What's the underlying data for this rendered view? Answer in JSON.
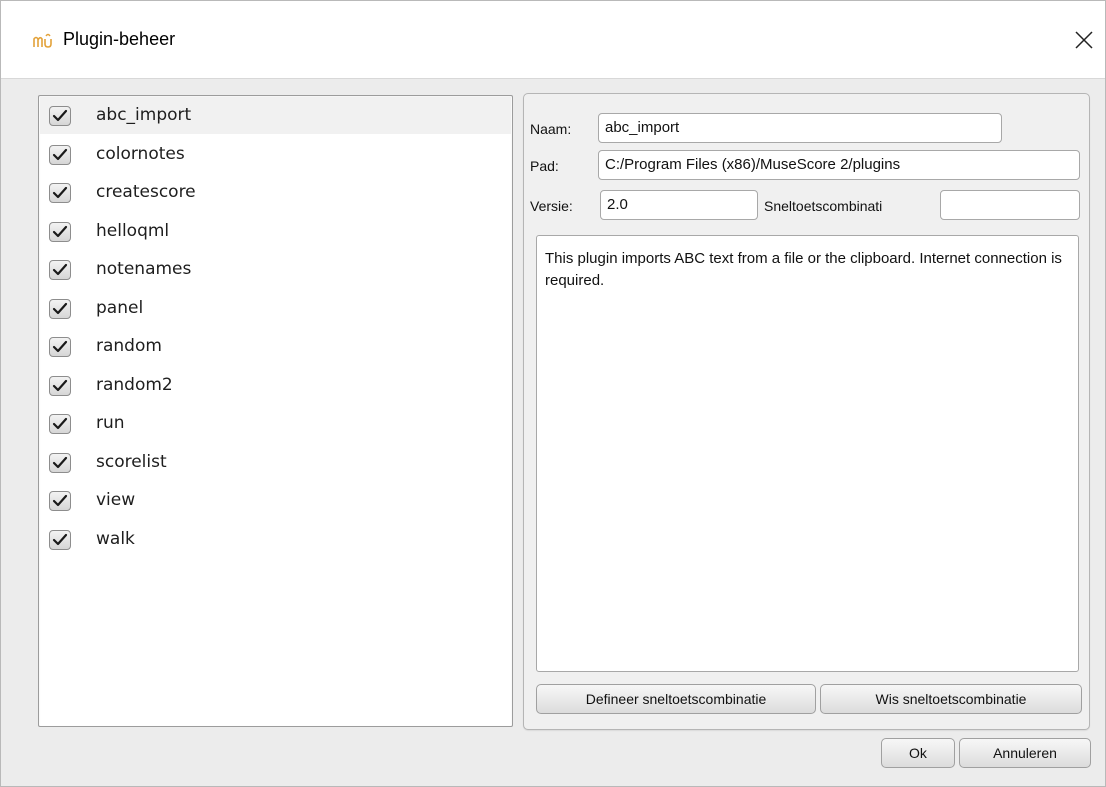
{
  "window": {
    "title": "Plugin-beheer"
  },
  "plugins": [
    {
      "label": "abc_import",
      "checked": true,
      "selected": true
    },
    {
      "label": "colornotes",
      "checked": true
    },
    {
      "label": "createscore",
      "checked": true
    },
    {
      "label": "helloqml",
      "checked": true
    },
    {
      "label": "notenames",
      "checked": true
    },
    {
      "label": "panel",
      "checked": true
    },
    {
      "label": "random",
      "checked": true
    },
    {
      "label": "random2",
      "checked": true
    },
    {
      "label": "run",
      "checked": true
    },
    {
      "label": "scorelist",
      "checked": true
    },
    {
      "label": "view",
      "checked": true
    },
    {
      "label": "walk",
      "checked": true
    }
  ],
  "details": {
    "name_label": "Naam:",
    "name_value": "abc_import",
    "path_label": "Pad:",
    "path_value": "C:/Program Files (x86)/MuseScore 2/plugins",
    "version_label": "Versie:",
    "version_value": "2.0",
    "shortcut_label": "Sneltoetscombinati",
    "shortcut_value": "",
    "description": "This plugin imports ABC text from a file or the clipboard. Internet connection is required.",
    "define_shortcut_label": "Defineer sneltoetscombinatie",
    "clear_shortcut_label": "Wis sneltoetscombinatie"
  },
  "footer": {
    "ok_label": "Ok",
    "cancel_label": "Annuleren"
  },
  "icons": {
    "app": "musescore-app-icon",
    "close": "close-icon",
    "check": "checkmark-icon"
  }
}
